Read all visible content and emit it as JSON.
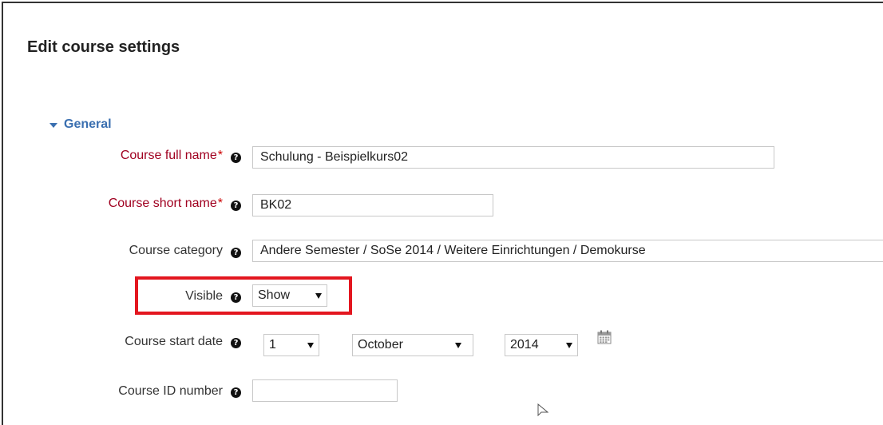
{
  "page": {
    "title": "Edit course settings"
  },
  "section": {
    "label": "General"
  },
  "fields": {
    "fullname": {
      "label": "Course full name",
      "required_mark": "*",
      "value": "Schulung - Beispielkurs02"
    },
    "shortname": {
      "label": "Course short name",
      "required_mark": "*",
      "value": "BK02"
    },
    "category": {
      "label": "Course category",
      "value": "Andere Semester / SoSe 2014 / Weitere Einrichtungen / Demokurse"
    },
    "visible": {
      "label": "Visible",
      "value": "Show"
    },
    "startdate": {
      "label": "Course start date",
      "day": "1",
      "month": "October",
      "year": "2014"
    },
    "idnumber": {
      "label": "Course ID number",
      "value": ""
    }
  },
  "help_icon_glyph": "?",
  "colors": {
    "required_label": "#a00020",
    "section_link": "#3a6fb0",
    "highlight": "#e3161f"
  },
  "icons": [
    "help-icon",
    "calendar-icon",
    "caret-down-icon",
    "mouse-cursor-icon"
  ]
}
